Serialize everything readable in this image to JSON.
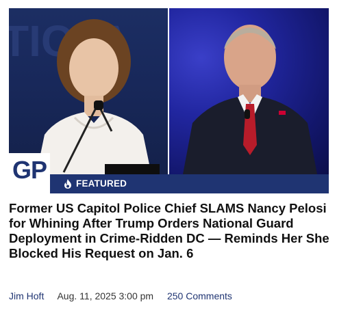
{
  "badge": {
    "label": "FEATURED",
    "icon": "flame-icon"
  },
  "logo": {
    "text": "GP"
  },
  "article": {
    "headline": "Former US Capitol Police Chief SLAMS Nancy Pelosi for Whining After Trump Orders National Guard Deployment in Crime-Ridden DC — Reminds Her She Blocked His Request on Jan. 6",
    "author": "Jim Hoft",
    "date": "Aug. 11, 2025 3:00 pm",
    "comments": "250 Comments"
  },
  "colors": {
    "brand_navy": "#1f3472",
    "banner": "#1f3472"
  }
}
